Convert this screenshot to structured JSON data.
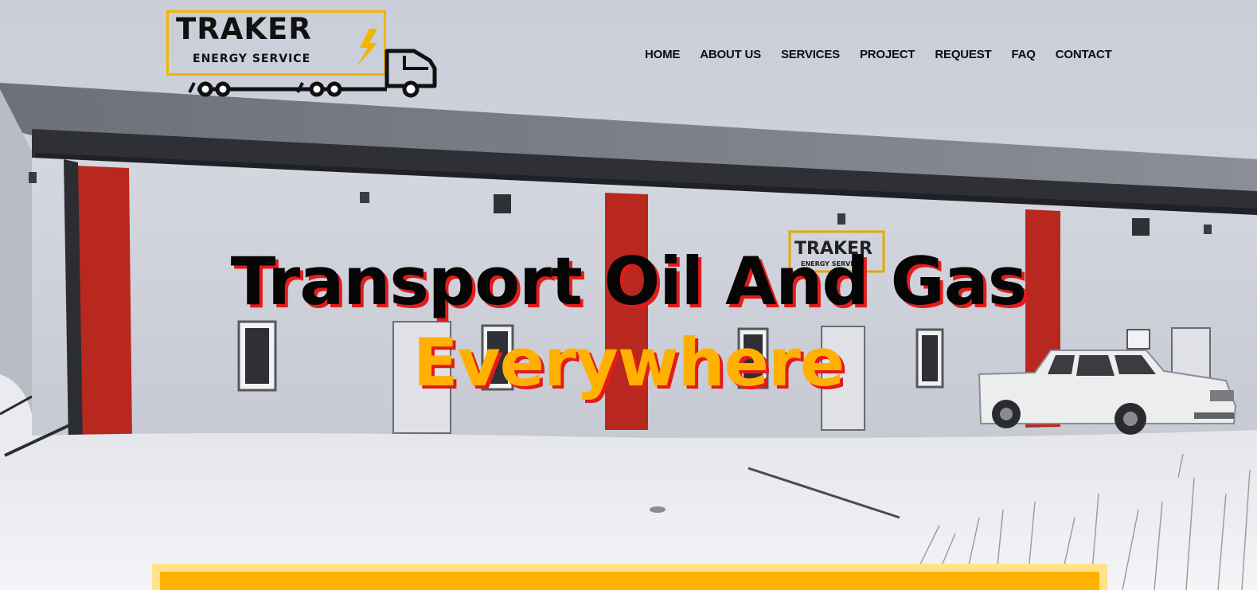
{
  "header": {
    "logo": {
      "name": "TRAKER",
      "tagline": "ENERGY SERVICE"
    },
    "nav": [
      {
        "label": "HOME"
      },
      {
        "label": "ABOUT US"
      },
      {
        "label": "SERVICES"
      },
      {
        "label": "PROJECT"
      },
      {
        "label": "REQUEST"
      },
      {
        "label": "FAQ"
      },
      {
        "label": "CONTACT"
      }
    ]
  },
  "hero": {
    "line1": "Transport Oil And Gas",
    "line2": "Everywhere"
  },
  "colors": {
    "brand_yellow": "#ffb000",
    "accent_red": "#e21b1b",
    "text_dark": "#0d0d0d"
  }
}
